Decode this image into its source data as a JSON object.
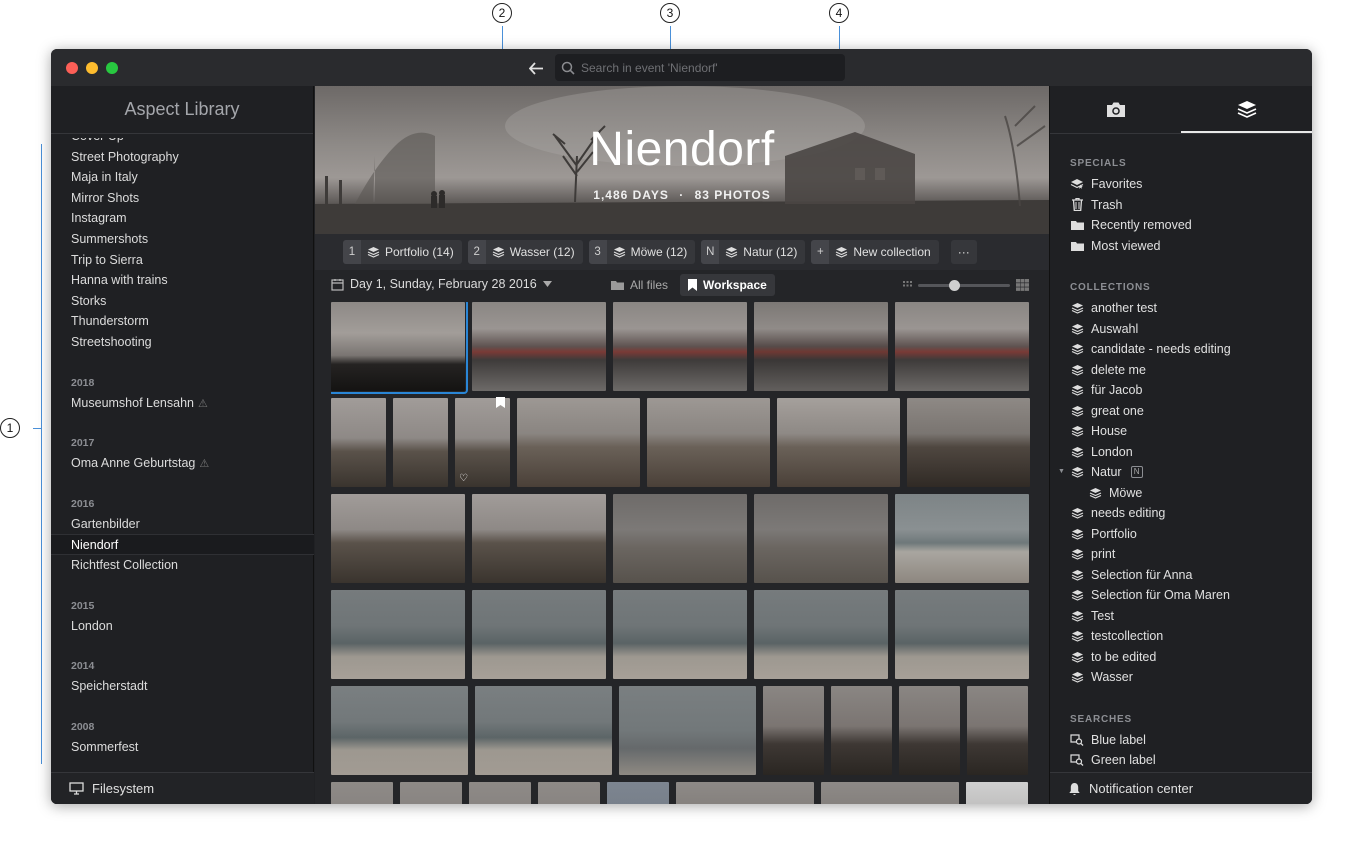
{
  "callouts": [
    "1",
    "2",
    "3",
    "4"
  ],
  "search": {
    "placeholder": "Search in event 'Niendorf'"
  },
  "library": {
    "title": "Aspect Library",
    "top_items": [
      "Cover Up",
      "Street Photography",
      "Maja in Italy",
      "Mirror Shots",
      "Instagram",
      "Summershots",
      "Trip to Sierra",
      "Hanna with trains",
      "Storks",
      "Thunderstorm",
      "Streetshooting"
    ],
    "years": [
      {
        "year": "2018",
        "items": [
          "Museumshof Lensahn"
        ],
        "warn": [
          true
        ]
      },
      {
        "year": "2017",
        "items": [
          "Oma Anne Geburtstag"
        ],
        "warn": [
          true
        ]
      },
      {
        "year": "2016",
        "items": [
          "Gartenbilder",
          "Niendorf",
          "Richtfest Collection"
        ],
        "active": "Niendorf"
      },
      {
        "year": "2015",
        "items": [
          "London"
        ]
      },
      {
        "year": "2014",
        "items": [
          "Speicherstadt"
        ]
      },
      {
        "year": "2008",
        "items": [
          "Sommerfest"
        ]
      }
    ],
    "footer": "Filesystem"
  },
  "event": {
    "title": "Niendorf",
    "days": "1,486 DAYS",
    "photos": "83 PHOTOS",
    "separator": "·"
  },
  "collections_bar": [
    {
      "key": "1",
      "label": "Portfolio (14)"
    },
    {
      "key": "2",
      "label": "Wasser (12)"
    },
    {
      "key": "3",
      "label": "Möwe (12)"
    },
    {
      "key": "N",
      "label": "Natur (12)"
    },
    {
      "key": "+",
      "label": "New collection"
    }
  ],
  "more_label": "···",
  "toolbar": {
    "day": "Day 1, Sunday, February 28 2016",
    "all_files": "All files",
    "workspace": "Workspace",
    "zoom_level": 0.38
  },
  "right": {
    "specials_heading": "SPECIALS",
    "specials": [
      {
        "icon": "favorites-icon",
        "label": "Favorites"
      },
      {
        "icon": "trash-icon",
        "label": "Trash"
      },
      {
        "icon": "folder-icon",
        "label": "Recently removed"
      },
      {
        "icon": "folder-icon",
        "label": "Most viewed"
      }
    ],
    "collections_heading": "COLLECTIONS",
    "collections": [
      "another test",
      "Auswahl",
      "candidate - needs editing",
      "delete me",
      "für Jacob",
      "great one",
      "House",
      "London",
      "Natur",
      "Möwe",
      "needs editing",
      "Portfolio",
      "print",
      "Selection für Anna",
      "Selection für Oma Maren",
      "Test",
      "testcollection",
      "to be edited",
      "Wasser"
    ],
    "natur_badge": "N",
    "searches_heading": "SEARCHES",
    "searches": [
      "Blue label",
      "Green label"
    ],
    "footer": "Notification center"
  },
  "colors": {
    "accent": "#2a86d6",
    "window_bg": "#202124"
  }
}
